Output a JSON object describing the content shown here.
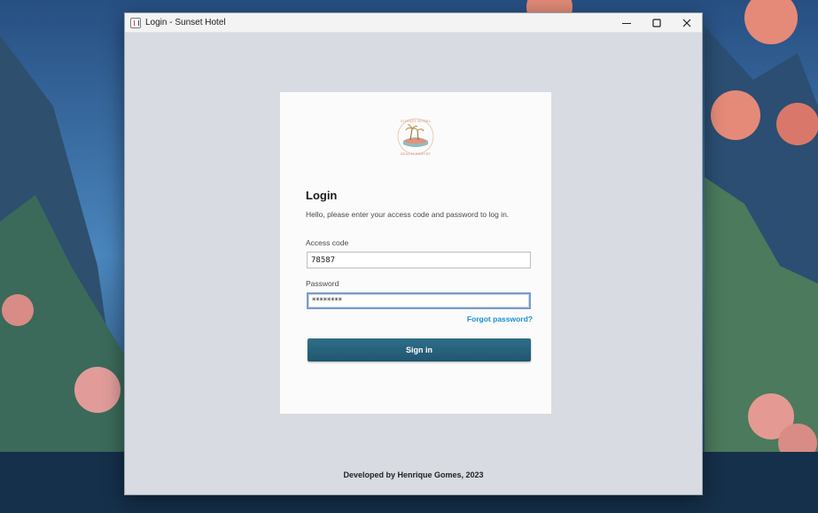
{
  "window": {
    "title": "Login - Sunset Hotel"
  },
  "logo": {
    "name": "sunset-hotel-beach-resort-logo",
    "text_top": "SUNSET HOTEL",
    "text_bottom": "BEACH RESORT"
  },
  "login": {
    "heading": "Login",
    "subtitle": "Hello, please enter your access code and password to log in.",
    "access_code_label": "Access code",
    "access_code_value": "78587",
    "password_label": "Password",
    "password_value": "********",
    "forgot_label": "Forgot password?",
    "signin_label": "Sign in"
  },
  "footer": {
    "text": "Developed by Henrique Gomes, 2023"
  },
  "colors": {
    "button": "#24627c",
    "link": "#1a8fd0",
    "window_bg": "#d8dbe1"
  }
}
